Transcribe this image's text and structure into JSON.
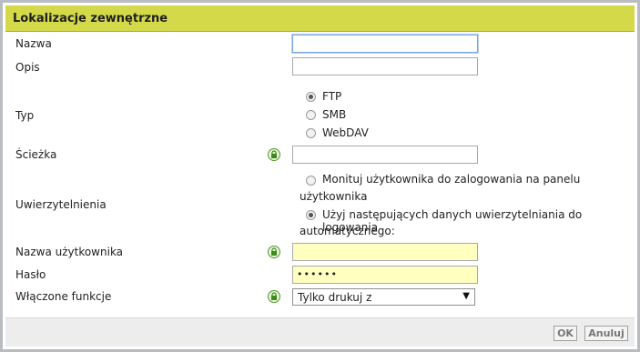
{
  "dialog": {
    "title": "Lokalizacje zewnętrzne"
  },
  "fields": {
    "nazwa": {
      "label": "Nazwa",
      "value": ""
    },
    "opis": {
      "label": "Opis",
      "value": ""
    },
    "typ": {
      "label": "Typ",
      "options": [
        "FTP",
        "SMB",
        "WebDAV"
      ],
      "selected": "FTP"
    },
    "sciezka": {
      "label": "Ścieżka",
      "value": ""
    },
    "uwierzytelnienia": {
      "label": "Uwierzytelnienia",
      "option1_line1": "Monituj użytkownika do zalogowania na panelu",
      "option1_line2": "użytkownika",
      "option2_line1": "Użyj następujących danych uwierzytelniania do logowania",
      "option2_line2": "automatycznego:",
      "selected": 2
    },
    "nazwa_uzytkownika": {
      "label": "Nazwa użytkownika",
      "value": ""
    },
    "haslo": {
      "label": "Hasło",
      "value": "••••••"
    },
    "funkcje": {
      "label": "Włączone funkcje",
      "selected": "Tylko drukuj z"
    }
  },
  "icons": {
    "lock": "lock-icon",
    "dropdown": "chevron-down-icon"
  },
  "footer": {
    "ok_label": "OK",
    "cancel_label": "Anuluj"
  },
  "colors": {
    "titlebar": "#d4d94a",
    "required_field": "#ffffc0",
    "lock": "#4d9a2a"
  }
}
